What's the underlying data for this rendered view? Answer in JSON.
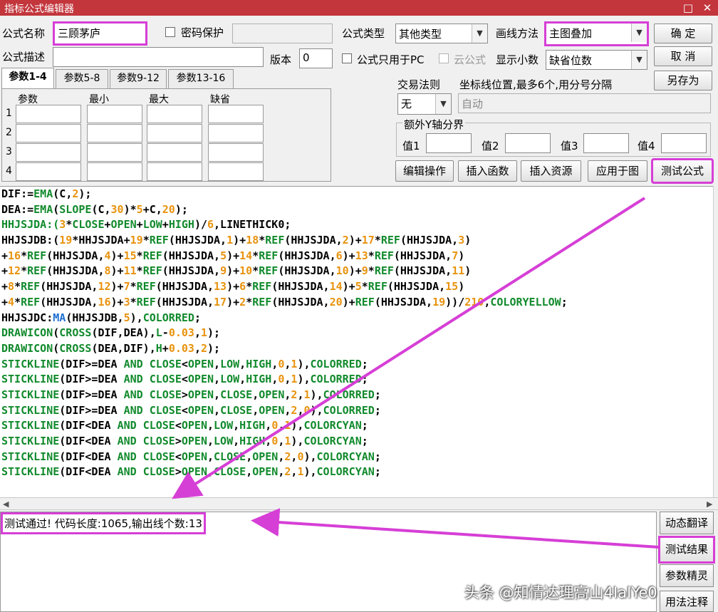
{
  "window": {
    "title": "指标公式编辑器",
    "restore_glyph": "□",
    "close_glyph": "✕"
  },
  "header": {
    "name_label": "公式名称",
    "name_value": "三顾茅庐",
    "password_label": "密码保护",
    "desc_label": "公式描述",
    "version_label": "版本",
    "version_value": "0",
    "pc_only_label": "公式只用于PC",
    "cloud_label": "云公式",
    "type_label": "公式类型",
    "type_value": "其他类型",
    "draw_label": "画线方法",
    "draw_value": "主图叠加",
    "decimal_label": "显示小数",
    "decimal_value": "缺省位数",
    "ok_label": "确  定",
    "cancel_label": "取  消",
    "saveas_label": "另存为"
  },
  "param_tabs": [
    "参数1-4",
    "参数5-8",
    "参数9-12",
    "参数13-16"
  ],
  "param_columns": [
    "参数",
    "最小",
    "最大",
    "缺省"
  ],
  "param_rows": [
    "1",
    "2",
    "3",
    "4"
  ],
  "trade": {
    "rule_label": "交易法则",
    "rule_value": "无",
    "coord_label": "坐标线位置,最多6个,用分号分隔",
    "coord_value": "自动",
    "extra_label": "额外Y轴分界",
    "val_labels": [
      "值1",
      "值2",
      "值3",
      "值4"
    ]
  },
  "actions": {
    "edit": "编辑操作",
    "insert_func": "插入函数",
    "insert_res": "插入资源",
    "apply": "应用于图",
    "test": "测试公式"
  },
  "code_lines": [
    [
      [
        "DIF:=",
        "k"
      ],
      [
        "EMA",
        "g"
      ],
      [
        "(",
        "k"
      ],
      [
        "C",
        "k"
      ],
      [
        ",",
        "k"
      ],
      [
        "2",
        "o"
      ],
      [
        ");",
        "k"
      ]
    ],
    [
      [
        "DEA:=",
        "k"
      ],
      [
        "EMA",
        "g"
      ],
      [
        "(",
        "k"
      ],
      [
        "SLOPE",
        "g"
      ],
      [
        "(",
        "k"
      ],
      [
        "C",
        "k"
      ],
      [
        ",",
        "k"
      ],
      [
        "30",
        "o"
      ],
      [
        ")*",
        "k"
      ],
      [
        "5",
        "o"
      ],
      [
        "+",
        "k"
      ],
      [
        "C",
        "k"
      ],
      [
        ",",
        "k"
      ],
      [
        "20",
        "o"
      ],
      [
        ");",
        "k"
      ]
    ],
    [
      [
        "HHJSJDA:(",
        "g"
      ],
      [
        "3",
        "o"
      ],
      [
        "*",
        "k"
      ],
      [
        "CLOSE",
        "g"
      ],
      [
        "+",
        "k"
      ],
      [
        "OPEN",
        "g"
      ],
      [
        "+",
        "k"
      ],
      [
        "LOW",
        "g"
      ],
      [
        "+",
        "k"
      ],
      [
        "HIGH",
        "g"
      ],
      [
        ")/",
        "k"
      ],
      [
        "6",
        "o"
      ],
      [
        ",LINETHICK0;",
        "k"
      ]
    ],
    [
      [
        "HHJSJDB:(",
        "k"
      ],
      [
        "19",
        "o"
      ],
      [
        "*HHJSJDA+",
        "k"
      ],
      [
        "19",
        "o"
      ],
      [
        "*",
        "k"
      ],
      [
        "REF",
        "g"
      ],
      [
        "(HHJSJDA,",
        "k"
      ],
      [
        "1",
        "o"
      ],
      [
        ")+",
        "k"
      ],
      [
        "18",
        "o"
      ],
      [
        "*",
        "k"
      ],
      [
        "REF",
        "g"
      ],
      [
        "(HHJSJDA,",
        "k"
      ],
      [
        "2",
        "o"
      ],
      [
        ")+",
        "k"
      ],
      [
        "17",
        "o"
      ],
      [
        "*",
        "k"
      ],
      [
        "REF",
        "g"
      ],
      [
        "(HHJSJDA,",
        "k"
      ],
      [
        "3",
        "o"
      ],
      [
        ")",
        "k"
      ]
    ],
    [
      [
        "+",
        "k"
      ],
      [
        "16",
        "o"
      ],
      [
        "*",
        "k"
      ],
      [
        "REF",
        "g"
      ],
      [
        "(HHJSJDA,",
        "k"
      ],
      [
        "4",
        "o"
      ],
      [
        ")+",
        "k"
      ],
      [
        "15",
        "o"
      ],
      [
        "*",
        "k"
      ],
      [
        "REF",
        "g"
      ],
      [
        "(HHJSJDA,",
        "k"
      ],
      [
        "5",
        "o"
      ],
      [
        ")+",
        "k"
      ],
      [
        "14",
        "o"
      ],
      [
        "*",
        "k"
      ],
      [
        "REF",
        "g"
      ],
      [
        "(HHJSJDA,",
        "k"
      ],
      [
        "6",
        "o"
      ],
      [
        ")+",
        "k"
      ],
      [
        "13",
        "o"
      ],
      [
        "*",
        "k"
      ],
      [
        "REF",
        "g"
      ],
      [
        "(HHJSJDA,",
        "k"
      ],
      [
        "7",
        "o"
      ],
      [
        ")",
        "k"
      ]
    ],
    [
      [
        "+",
        "k"
      ],
      [
        "12",
        "o"
      ],
      [
        "*",
        "k"
      ],
      [
        "REF",
        "g"
      ],
      [
        "(HHJSJDA,",
        "k"
      ],
      [
        "8",
        "o"
      ],
      [
        ")+",
        "k"
      ],
      [
        "11",
        "o"
      ],
      [
        "*",
        "k"
      ],
      [
        "REF",
        "g"
      ],
      [
        "(HHJSJDA,",
        "k"
      ],
      [
        "9",
        "o"
      ],
      [
        ")+",
        "k"
      ],
      [
        "10",
        "o"
      ],
      [
        "*",
        "k"
      ],
      [
        "REF",
        "g"
      ],
      [
        "(HHJSJDA,",
        "k"
      ],
      [
        "10",
        "o"
      ],
      [
        ")+",
        "k"
      ],
      [
        "9",
        "o"
      ],
      [
        "*",
        "k"
      ],
      [
        "REF",
        "g"
      ],
      [
        "(HHJSJDA,",
        "k"
      ],
      [
        "11",
        "o"
      ],
      [
        ")",
        "k"
      ]
    ],
    [
      [
        "+",
        "k"
      ],
      [
        "8",
        "o"
      ],
      [
        "*",
        "k"
      ],
      [
        "REF",
        "g"
      ],
      [
        "(HHJSJDA,",
        "k"
      ],
      [
        "12",
        "o"
      ],
      [
        ")+",
        "k"
      ],
      [
        "7",
        "o"
      ],
      [
        "*",
        "k"
      ],
      [
        "REF",
        "g"
      ],
      [
        "(HHJSJDA,",
        "k"
      ],
      [
        "13",
        "o"
      ],
      [
        ")+",
        "k"
      ],
      [
        "6",
        "o"
      ],
      [
        "*",
        "k"
      ],
      [
        "REF",
        "g"
      ],
      [
        "(HHJSJDA,",
        "k"
      ],
      [
        "14",
        "o"
      ],
      [
        ")+",
        "k"
      ],
      [
        "5",
        "o"
      ],
      [
        "*",
        "k"
      ],
      [
        "REF",
        "g"
      ],
      [
        "(HHJSJDA,",
        "k"
      ],
      [
        "15",
        "o"
      ],
      [
        ")",
        "k"
      ]
    ],
    [
      [
        "+",
        "k"
      ],
      [
        "4",
        "o"
      ],
      [
        "*",
        "k"
      ],
      [
        "REF",
        "g"
      ],
      [
        "(HHJSJDA,",
        "k"
      ],
      [
        "16",
        "o"
      ],
      [
        ")+",
        "k"
      ],
      [
        "3",
        "o"
      ],
      [
        "*",
        "k"
      ],
      [
        "REF",
        "g"
      ],
      [
        "(HHJSJDA,",
        "k"
      ],
      [
        "17",
        "o"
      ],
      [
        ")+",
        "k"
      ],
      [
        "2",
        "o"
      ],
      [
        "*",
        "k"
      ],
      [
        "REF",
        "g"
      ],
      [
        "(HHJSJDA,",
        "k"
      ],
      [
        "20",
        "o"
      ],
      [
        ")+",
        "k"
      ],
      [
        "REF",
        "g"
      ],
      [
        "(HHJSJDA,",
        "k"
      ],
      [
        "19",
        "o"
      ],
      [
        "))/",
        "k"
      ],
      [
        "210",
        "o"
      ],
      [
        ",",
        "k"
      ],
      [
        "COLORYELLOW",
        "g"
      ],
      [
        ";",
        "k"
      ]
    ],
    [
      [
        "HHJSJDC:",
        "k"
      ],
      [
        "MA",
        "b"
      ],
      [
        "(HHJSJDB,",
        "k"
      ],
      [
        "5",
        "o"
      ],
      [
        "),",
        "k"
      ],
      [
        "COLORRED",
        "g"
      ],
      [
        ";",
        "k"
      ]
    ],
    [
      [
        "DRAWICON",
        "g"
      ],
      [
        "(",
        "k"
      ],
      [
        "CROSS",
        "g"
      ],
      [
        "(DIF,DEA),",
        "k"
      ],
      [
        "L",
        "g"
      ],
      [
        "-",
        "k"
      ],
      [
        "0.03",
        "o"
      ],
      [
        ",",
        "k"
      ],
      [
        "1",
        "o"
      ],
      [
        ");",
        "k"
      ]
    ],
    [
      [
        "DRAWICON",
        "g"
      ],
      [
        "(",
        "k"
      ],
      [
        "CROSS",
        "g"
      ],
      [
        "(DEA,DIF),",
        "k"
      ],
      [
        "H",
        "g"
      ],
      [
        "+",
        "k"
      ],
      [
        "0.03",
        "o"
      ],
      [
        ",",
        "k"
      ],
      [
        "2",
        "o"
      ],
      [
        ");",
        "k"
      ]
    ],
    [
      [
        "STICKLINE",
        "g"
      ],
      [
        "(DIF>=DEA ",
        "k"
      ],
      [
        "AND",
        "g"
      ],
      [
        " ",
        "k"
      ],
      [
        "CLOSE",
        "g"
      ],
      [
        "<",
        "k"
      ],
      [
        "OPEN",
        "g"
      ],
      [
        ",",
        "k"
      ],
      [
        "LOW",
        "g"
      ],
      [
        ",",
        "k"
      ],
      [
        "HIGH",
        "g"
      ],
      [
        ",",
        "k"
      ],
      [
        "0",
        "o"
      ],
      [
        ",",
        "k"
      ],
      [
        "1",
        "o"
      ],
      [
        "),",
        "k"
      ],
      [
        "COLORRED",
        "g"
      ],
      [
        ";",
        "k"
      ]
    ],
    [
      [
        "STICKLINE",
        "g"
      ],
      [
        "(DIF>=DEA ",
        "k"
      ],
      [
        "AND",
        "g"
      ],
      [
        " ",
        "k"
      ],
      [
        "CLOSE",
        "g"
      ],
      [
        "<",
        "k"
      ],
      [
        "OPEN",
        "g"
      ],
      [
        ",",
        "k"
      ],
      [
        "LOW",
        "g"
      ],
      [
        ",",
        "k"
      ],
      [
        "HIGH",
        "g"
      ],
      [
        ",",
        "k"
      ],
      [
        "0",
        "o"
      ],
      [
        ",",
        "k"
      ],
      [
        "1",
        "o"
      ],
      [
        "),",
        "k"
      ],
      [
        "COLORRED",
        "g"
      ],
      [
        ";",
        "k"
      ]
    ],
    [
      [
        "STICKLINE",
        "g"
      ],
      [
        "(DIF>=DEA ",
        "k"
      ],
      [
        "AND",
        "g"
      ],
      [
        " ",
        "k"
      ],
      [
        "CLOSE",
        "g"
      ],
      [
        ">",
        "k"
      ],
      [
        "OPEN",
        "g"
      ],
      [
        ",",
        "k"
      ],
      [
        "CLOSE",
        "g"
      ],
      [
        ",",
        "k"
      ],
      [
        "OPEN",
        "g"
      ],
      [
        ",",
        "k"
      ],
      [
        "2",
        "o"
      ],
      [
        ",",
        "k"
      ],
      [
        "1",
        "o"
      ],
      [
        "),",
        "k"
      ],
      [
        "COLORRED",
        "g"
      ],
      [
        ";",
        "k"
      ]
    ],
    [
      [
        "STICKLINE",
        "g"
      ],
      [
        "(DIF>=DEA ",
        "k"
      ],
      [
        "AND",
        "g"
      ],
      [
        " ",
        "k"
      ],
      [
        "CLOSE",
        "g"
      ],
      [
        "<",
        "k"
      ],
      [
        "OPEN",
        "g"
      ],
      [
        ",",
        "k"
      ],
      [
        "CLOSE",
        "g"
      ],
      [
        ",",
        "k"
      ],
      [
        "OPEN",
        "g"
      ],
      [
        ",",
        "k"
      ],
      [
        "2",
        "o"
      ],
      [
        ",",
        "k"
      ],
      [
        "0",
        "o"
      ],
      [
        "),",
        "k"
      ],
      [
        "COLORRED",
        "g"
      ],
      [
        ";",
        "k"
      ]
    ],
    [
      [
        "STICKLINE",
        "g"
      ],
      [
        "(DIF<DEA ",
        "k"
      ],
      [
        "AND",
        "g"
      ],
      [
        " ",
        "k"
      ],
      [
        "CLOSE",
        "g"
      ],
      [
        "<",
        "k"
      ],
      [
        "OPEN",
        "g"
      ],
      [
        ",",
        "k"
      ],
      [
        "LOW",
        "g"
      ],
      [
        ",",
        "k"
      ],
      [
        "HIGH",
        "g"
      ],
      [
        ",",
        "k"
      ],
      [
        "0",
        "o"
      ],
      [
        ",",
        "k"
      ],
      [
        "1",
        "o"
      ],
      [
        "),",
        "k"
      ],
      [
        "COLORCYAN",
        "g"
      ],
      [
        ";",
        "k"
      ]
    ],
    [
      [
        "STICKLINE",
        "g"
      ],
      [
        "(DIF<DEA ",
        "k"
      ],
      [
        "AND",
        "g"
      ],
      [
        " ",
        "k"
      ],
      [
        "CLOSE",
        "g"
      ],
      [
        ">",
        "k"
      ],
      [
        "OPEN",
        "g"
      ],
      [
        ",",
        "k"
      ],
      [
        "LOW",
        "g"
      ],
      [
        ",",
        "k"
      ],
      [
        "HIGH",
        "g"
      ],
      [
        ",",
        "k"
      ],
      [
        "0",
        "o"
      ],
      [
        ",",
        "k"
      ],
      [
        "1",
        "o"
      ],
      [
        "),",
        "k"
      ],
      [
        "COLORCYAN",
        "g"
      ],
      [
        ";",
        "k"
      ]
    ],
    [
      [
        "STICKLINE",
        "g"
      ],
      [
        "(DIF<DEA ",
        "k"
      ],
      [
        "AND",
        "g"
      ],
      [
        " ",
        "k"
      ],
      [
        "CLOSE",
        "g"
      ],
      [
        "<",
        "k"
      ],
      [
        "OPEN",
        "g"
      ],
      [
        ",",
        "k"
      ],
      [
        "CLOSE",
        "g"
      ],
      [
        ",",
        "k"
      ],
      [
        "OPEN",
        "g"
      ],
      [
        ",",
        "k"
      ],
      [
        "2",
        "o"
      ],
      [
        ",",
        "k"
      ],
      [
        "0",
        "o"
      ],
      [
        "),",
        "k"
      ],
      [
        "COLORCYAN",
        "g"
      ],
      [
        ";",
        "k"
      ]
    ],
    [
      [
        "STICKLINE",
        "g"
      ],
      [
        "(DIF<DEA ",
        "k"
      ],
      [
        "AND",
        "g"
      ],
      [
        " ",
        "k"
      ],
      [
        "CLOSE",
        "g"
      ],
      [
        ">",
        "k"
      ],
      [
        "OPEN",
        "g"
      ],
      [
        ",",
        "k"
      ],
      [
        "CLOSE",
        "g"
      ],
      [
        ",",
        "k"
      ],
      [
        "OPEN",
        "g"
      ],
      [
        ",",
        "k"
      ],
      [
        "2",
        "o"
      ],
      [
        ",",
        "k"
      ],
      [
        "1",
        "o"
      ],
      [
        "),",
        "k"
      ],
      [
        "COLORCYAN",
        "g"
      ],
      [
        ";",
        "k"
      ]
    ]
  ],
  "token_colors": {
    "k": "#000000",
    "g": "#118a2c",
    "o": "#e8930e",
    "b": "#1e6fd0"
  },
  "result": {
    "text": "测试通过! 代码长度:1065,输出线个数:13"
  },
  "side_buttons": [
    "动态翻译",
    "测试结果",
    "参数精灵",
    "用法注释"
  ],
  "watermark": "头条 @知情达理高山4IaIYe0",
  "colors": {
    "titlebar": "#c2363c",
    "highlight": "#d63fd6"
  }
}
